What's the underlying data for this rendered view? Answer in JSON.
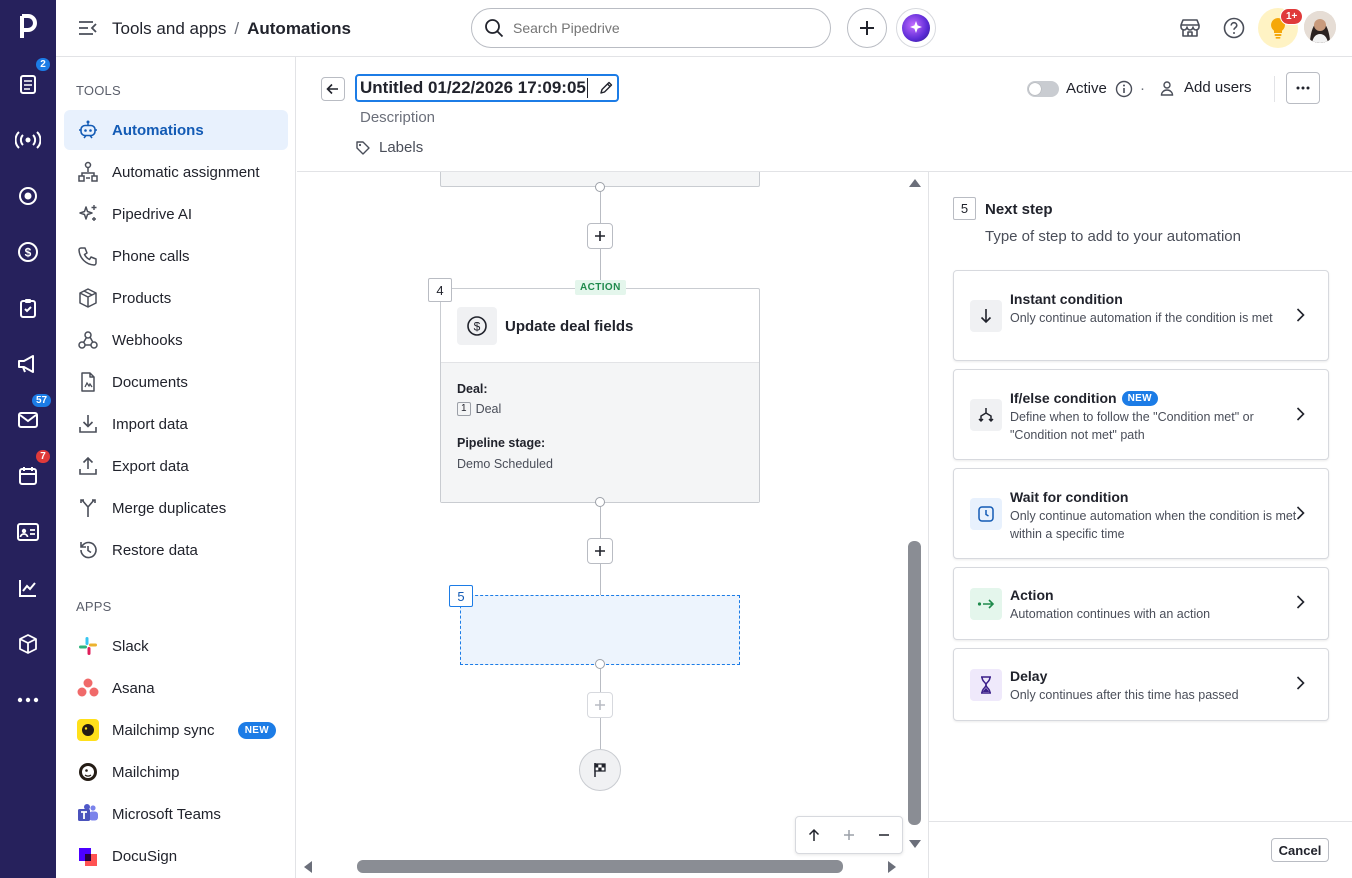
{
  "topbar": {
    "breadcrumb_parent": "Tools and apps",
    "breadcrumb_sep": "/",
    "breadcrumb_current": "Automations",
    "search_placeholder": "Search Pipedrive",
    "notification_badge": "1+"
  },
  "rail": {
    "badges": {
      "activities": "2",
      "mail": "57",
      "calendar": "7"
    }
  },
  "sidebar": {
    "tools_heading": "TOOLS",
    "tools": [
      {
        "label": "Automations"
      },
      {
        "label": "Automatic assignment"
      },
      {
        "label": "Pipedrive AI"
      },
      {
        "label": "Phone calls"
      },
      {
        "label": "Products"
      },
      {
        "label": "Webhooks"
      },
      {
        "label": "Documents"
      },
      {
        "label": "Import data"
      },
      {
        "label": "Export data"
      },
      {
        "label": "Merge duplicates"
      },
      {
        "label": "Restore data"
      }
    ],
    "apps_heading": "APPS",
    "apps": [
      {
        "label": "Slack"
      },
      {
        "label": "Asana"
      },
      {
        "label": "Mailchimp sync",
        "badge": "NEW"
      },
      {
        "label": "Mailchimp"
      },
      {
        "label": "Microsoft Teams"
      },
      {
        "label": "DocuSign"
      }
    ]
  },
  "header": {
    "title_value": "Untitled 01/22/2026 17:09:05",
    "description_placeholder": "Description",
    "labels_label": "Labels",
    "active_label": "Active",
    "dot_sep": "·",
    "add_users_label": "Add users"
  },
  "canvas": {
    "step4": {
      "number": "4",
      "tag": "ACTION",
      "title": "Update deal fields",
      "field1_label": "Deal:",
      "field1_ref": "1",
      "field1_value": "Deal",
      "field2_label": "Pipeline stage:",
      "field2_value": "Demo Scheduled"
    },
    "step5": {
      "number": "5"
    }
  },
  "panel": {
    "step_number": "5",
    "title": "Next step",
    "subtitle": "Type of step to add to your automation",
    "options": [
      {
        "title": "Instant condition",
        "desc": "Only continue automation if the condition is met",
        "icon": "arrow-down-icon"
      },
      {
        "title": "If/else condition",
        "badge": "NEW",
        "desc": "Define when to follow the \"Condition met\" or \"Condition not met\" path",
        "icon": "branch-icon"
      },
      {
        "title": "Wait for condition",
        "desc": "Only continue automation when the condition is met within a specific time",
        "icon": "clock-icon"
      },
      {
        "title": "Action",
        "desc": "Automation continues with an action",
        "icon": "arrow-right-icon"
      },
      {
        "title": "Delay",
        "desc": "Only continues after this time has passed",
        "icon": "hourglass-icon"
      }
    ],
    "cancel_label": "Cancel"
  },
  "colors": {
    "rail": "#26215c",
    "accent": "#1c7ce6",
    "active_bg": "#e8f1fd",
    "action_green": "#1f8a4c"
  }
}
